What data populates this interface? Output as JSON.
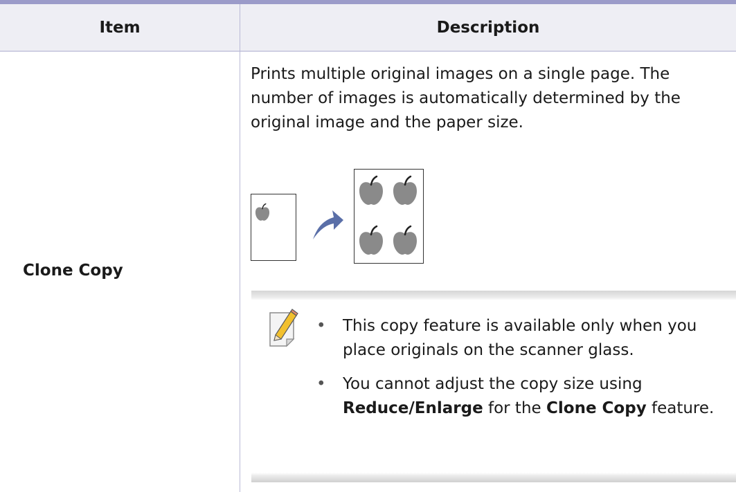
{
  "table": {
    "header": {
      "item": "Item",
      "description": "Description"
    },
    "row": {
      "item": "Clone Copy",
      "description": "Prints multiple original images on a single page. The number of images is automatically determined by the original image and the paper size."
    }
  },
  "illustration": {
    "icons": [
      "apple-icon",
      "curved-arrow-icon"
    ],
    "colors": {
      "apple": "#8a8a8a",
      "arrow": "#5a6fa8"
    }
  },
  "note": {
    "icon": "note-pencil-icon",
    "bullet1": "This copy feature is available only when you place originals on the scanner glass.",
    "bullet2": {
      "text1": "You cannot adjust the copy size using ",
      "bold1": "Reduce/Enlarge",
      "text2": " for the ",
      "bold2": "Clone Copy",
      "text3": " feature."
    }
  },
  "colors": {
    "header_background": "#eeeef4",
    "top_rule": "#9b9bc9",
    "column_divider": "#b9b9d6"
  }
}
